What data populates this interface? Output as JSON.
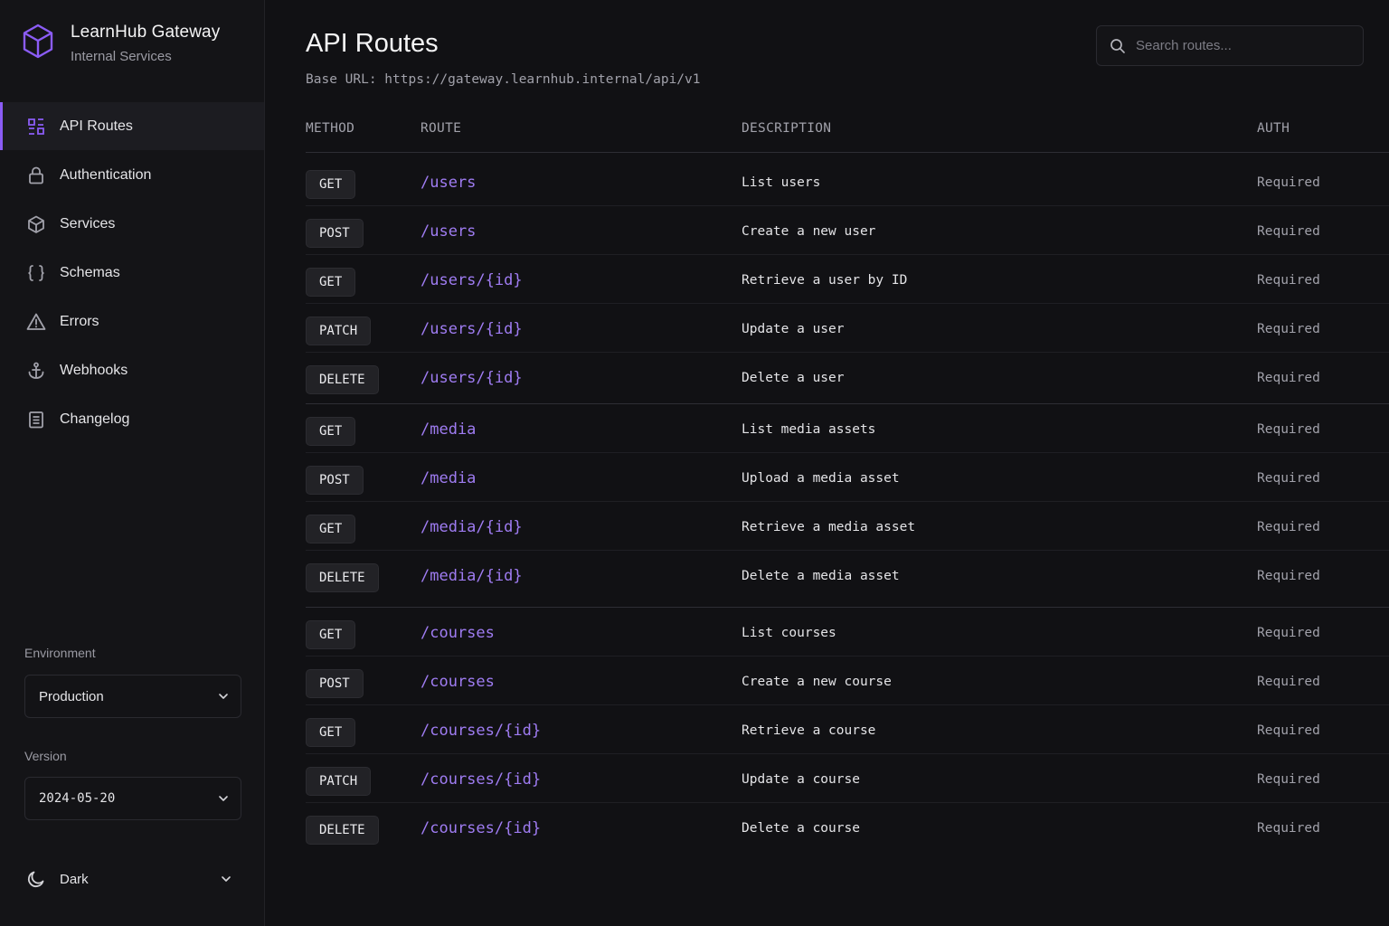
{
  "brand": {
    "title": "LearnHub Gateway",
    "subtitle": "Internal Services"
  },
  "nav": {
    "items": [
      {
        "label": "API Routes",
        "icon": "routes-icon",
        "active": true
      },
      {
        "label": "Authentication",
        "icon": "lock-icon"
      },
      {
        "label": "Services",
        "icon": "cube-icon"
      },
      {
        "label": "Schemas",
        "icon": "braces-icon"
      },
      {
        "label": "Errors",
        "icon": "warning-icon"
      },
      {
        "label": "Webhooks",
        "icon": "anchor-icon"
      },
      {
        "label": "Changelog",
        "icon": "document-icon"
      }
    ]
  },
  "environment": {
    "label": "Environment",
    "value": "Production"
  },
  "version": {
    "label": "Version",
    "value": "2024-05-20"
  },
  "theme": {
    "label": "Dark"
  },
  "page": {
    "title": "API Routes",
    "base_url": "Base URL: https://gateway.learnhub.internal/api/v1"
  },
  "search": {
    "placeholder": "Search routes..."
  },
  "table": {
    "headers": {
      "method": "METHOD",
      "route": "ROUTE",
      "description": "DESCRIPTION",
      "auth": "AUTH"
    },
    "groups": [
      [
        {
          "method": "GET",
          "route": "/users",
          "description": "List users",
          "auth": "Required"
        },
        {
          "method": "POST",
          "route": "/users",
          "description": "Create a new user",
          "auth": "Required"
        },
        {
          "method": "GET",
          "route": "/users/{id}",
          "description": "Retrieve a user by ID",
          "auth": "Required"
        },
        {
          "method": "PATCH",
          "route": "/users/{id}",
          "description": "Update a user",
          "auth": "Required"
        },
        {
          "method": "DELETE",
          "route": "/users/{id}",
          "description": "Delete a user",
          "auth": "Required"
        }
      ],
      [
        {
          "method": "GET",
          "route": "/media",
          "description": "List media assets",
          "auth": "Required"
        },
        {
          "method": "POST",
          "route": "/media",
          "description": "Upload a media asset",
          "auth": "Required"
        },
        {
          "method": "GET",
          "route": "/media/{id}",
          "description": "Retrieve a media asset",
          "auth": "Required"
        },
        {
          "method": "DELETE",
          "route": "/media/{id}",
          "description": "Delete a media asset",
          "auth": "Required"
        }
      ],
      [
        {
          "method": "GET",
          "route": "/courses",
          "description": "List courses",
          "auth": "Required"
        },
        {
          "method": "POST",
          "route": "/courses",
          "description": "Create a new course",
          "auth": "Required"
        },
        {
          "method": "GET",
          "route": "/courses/{id}",
          "description": "Retrieve a course",
          "auth": "Required"
        },
        {
          "method": "PATCH",
          "route": "/courses/{id}",
          "description": "Update a course",
          "auth": "Required"
        },
        {
          "method": "DELETE",
          "route": "/courses/{id}",
          "description": "Delete a course",
          "auth": "Required"
        }
      ]
    ]
  },
  "colors": {
    "accent": "#8b5cf6",
    "route": "#9f7cf2",
    "background": "#111114",
    "sidebar": "#141417"
  }
}
